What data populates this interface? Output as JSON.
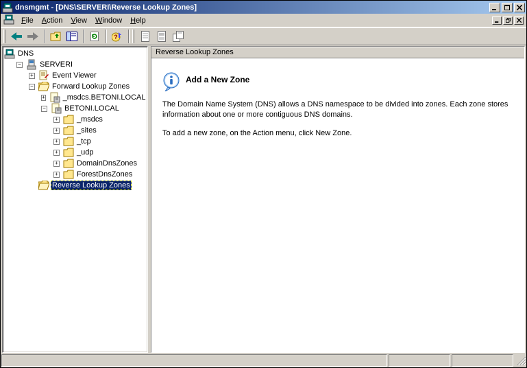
{
  "titlebar": {
    "title": "dnsmgmt - [DNS\\SERVERI\\Reverse Lookup Zones]"
  },
  "menu": {
    "file": "File",
    "action": "Action",
    "view": "View",
    "window": "Window",
    "help": "Help"
  },
  "tree": {
    "root": "DNS",
    "server": "SERVERI",
    "event_viewer": "Event Viewer",
    "flz": "Forward Lookup Zones",
    "msdcs_betoni": "_msdcs.BETONI.LOCAL",
    "betoni_local": "BETONI.LOCAL",
    "msdcs": "_msdcs",
    "sites": "_sites",
    "tcp": "_tcp",
    "udp": "_udp",
    "domaindns": "DomainDnsZones",
    "forestdns": "ForestDnsZones",
    "rlz": "Reverse Lookup Zones"
  },
  "content": {
    "header": "Reverse Lookup Zones",
    "info_title": "Add a New Zone",
    "para1": "The Domain Name System (DNS) allows a DNS namespace to be divided into zones. Each zone stores information about one or more contiguous DNS domains.",
    "para2": "To add a new zone, on the Action menu, click New Zone."
  }
}
